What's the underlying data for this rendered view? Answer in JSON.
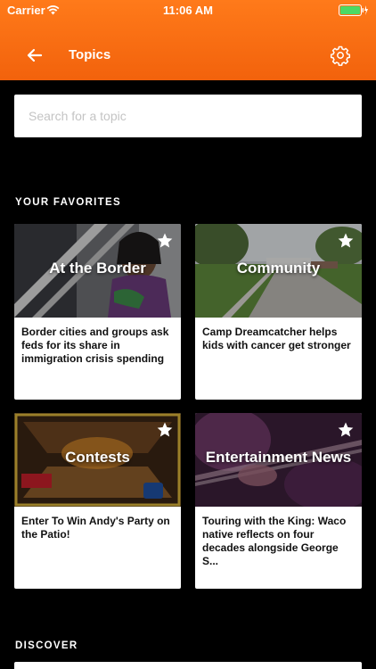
{
  "status_bar": {
    "carrier": "Carrier",
    "time": "11:06 AM"
  },
  "header": {
    "title": "Topics"
  },
  "search": {
    "placeholder": "Search for a topic"
  },
  "sections": {
    "favorites_label": "YOUR FAVORITES",
    "discover_label": "DISCOVER"
  },
  "favorites": [
    {
      "topic": "At the Border",
      "headline": "Border cities and groups ask feds for its share in immigration crisis spending",
      "starred": true
    },
    {
      "topic": "Community",
      "headline": "Camp Dreamcatcher helps kids with cancer get stronger",
      "starred": true
    },
    {
      "topic": "Contests",
      "headline": "Enter To Win Andy's Party on the Patio!",
      "starred": true
    },
    {
      "topic": "Entertainment News",
      "headline": "Touring with the King: Waco native reflects on four decades alongside George S...",
      "starred": true
    }
  ],
  "colors": {
    "header_orange": "#f2620c",
    "background": "#000000",
    "card": "#ffffff"
  }
}
